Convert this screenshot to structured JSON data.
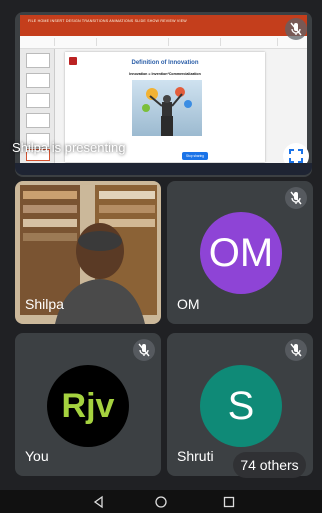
{
  "presentation": {
    "presenter_label": "Shilpa is presenting",
    "slide_title": "Definition of Innovation",
    "slide_subtitle": "Innovation = Invention*Commercialization",
    "stop_presenting_label": "Stop sharing",
    "ribbon_tabs": "FILE  HOME  INSERT  DESIGN  TRANSITIONS  ANIMATIONS  SLIDE SHOW  REVIEW  VIEW"
  },
  "participants": [
    {
      "name": "Shilpa",
      "type": "video"
    },
    {
      "name": "OM",
      "initials": "OM",
      "avatar_color": "#8e44d6",
      "muted": true
    },
    {
      "name": "You",
      "initials": "Rjv",
      "avatar_color": "#000000",
      "initials_color": "#a5d23f",
      "muted": true
    },
    {
      "name": "Shruti",
      "initials": "S",
      "avatar_color": "#0f8a77",
      "muted": true
    }
  ],
  "others_label": "74 others",
  "icons": {
    "mic_off": "mic-off-icon",
    "fullscreen": "fullscreen-icon",
    "back": "back-icon",
    "home": "home-icon",
    "recents": "recents-icon"
  },
  "colors": {
    "background": "#202124",
    "tile": "#3c4043",
    "accent": "#1a73e8"
  }
}
